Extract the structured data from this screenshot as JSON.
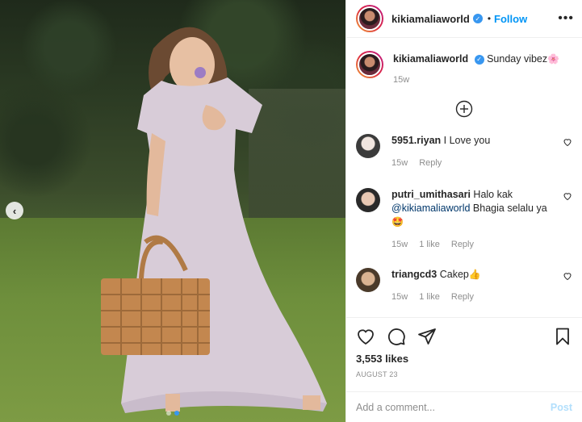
{
  "post": {
    "username": "kikiamaliaworld",
    "follow_label": "Follow",
    "more_label": "•••",
    "caption": {
      "username": "kikiamaliaworld",
      "text": "Sunday vibez",
      "emoji": "🌸",
      "time": "15w"
    },
    "comments": [
      {
        "username": "5951.riyan",
        "text": "I Love you",
        "time": "15w",
        "likes": "",
        "reply": "Reply"
      },
      {
        "username": "putri_umithasari",
        "text": "Halo kak",
        "mention": "@kikiamaliaworld",
        "text2": "Bhagia selalu ya",
        "emoji": "🤩",
        "time": "15w",
        "likes": "1 like",
        "reply": "Reply"
      },
      {
        "username": "triangcd3",
        "text": "Cakep",
        "emoji": "👍",
        "time": "15w",
        "likes": "1 like",
        "reply": "Reply"
      }
    ],
    "likes": "3,553 likes",
    "date": "AUGUST 23",
    "add_comment_placeholder": "Add a comment...",
    "post_button": "Post",
    "carousel": {
      "total": 2,
      "active": 1
    }
  },
  "colors": {
    "accent": "#0095f6",
    "verified": "#3897f0",
    "muted": "#8e8e8e",
    "post_disabled": "#b2dffc"
  },
  "icons": [
    "verified-badge-icon",
    "more-options-icon",
    "load-more-icon",
    "heart-icon",
    "comment-icon",
    "share-icon",
    "bookmark-icon",
    "chevron-left-icon"
  ]
}
